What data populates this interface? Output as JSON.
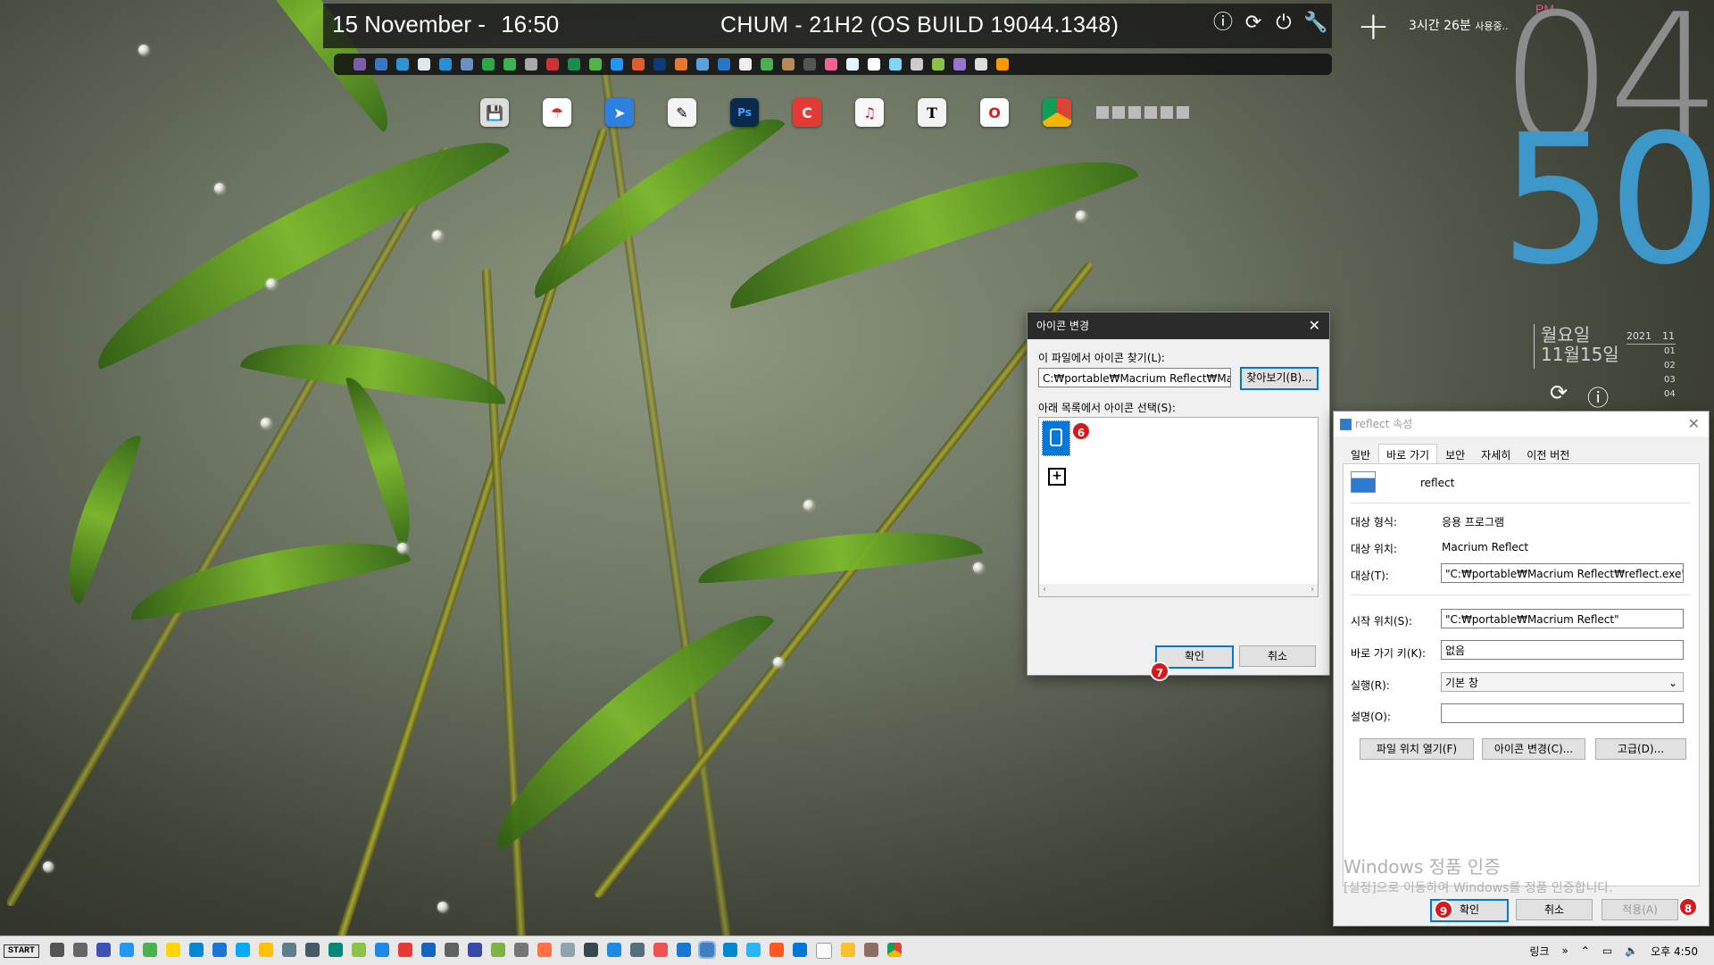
{
  "topbar": {
    "date": "15 November -",
    "time": "16:50",
    "title": "CHUM - 21H2 (OS BUILD 19044.1348)"
  },
  "usage": {
    "text": "3시간 26분",
    "suffix": "사용중.."
  },
  "clock": {
    "ampm": "PM",
    "hour": "04",
    "minute": "50",
    "dayname": "월요일",
    "date": "11월15일",
    "year": "2021",
    "month": "11",
    "days": [
      "01",
      "02",
      "03",
      "04"
    ]
  },
  "icon_dialog": {
    "title": "아이콘 변경",
    "find_label": "이 파일에서 아이콘 찾기(L):",
    "path_value": "C:₩portable₩Macrium Reflect₩Macriu",
    "browse_label": "찾아보기(B)...",
    "list_label": "아래 목록에서 아이콘 선택(S):",
    "ok_label": "확인",
    "cancel_label": "취소",
    "badge_a": "6",
    "badge_b": "7"
  },
  "props": {
    "title": "reflect 속성",
    "tabs": [
      "일반",
      "바로 가기",
      "보안",
      "자세히",
      "이전 버전"
    ],
    "app_name": "reflect",
    "target_type_label": "대상 형식:",
    "target_type_value": "응용 프로그램",
    "target_loc_label": "대상 위치:",
    "target_loc_value": "Macrium Reflect",
    "target_label": "대상(T):",
    "target_value": "\"C:₩portable₩Macrium Reflect₩reflect.exe\"",
    "start_label": "시작 위치(S):",
    "start_value": "\"C:₩portable₩Macrium Reflect\"",
    "hotkey_label": "바로 가기 키(K):",
    "hotkey_value": "없음",
    "run_label": "실행(R):",
    "run_value": "기본 창",
    "comment_label": "설명(O):",
    "comment_value": "",
    "btn_open_loc": "파일 위치 열기(F)",
    "btn_change_icon": "아이콘 변경(C)...",
    "btn_advanced": "고급(D)...",
    "ok_label": "확인",
    "cancel_label": "취소",
    "apply_label": "적용(A)",
    "badge_ok": "9",
    "badge_apply": "8"
  },
  "watermark": {
    "line1": "Windows 정품 인증",
    "line2": "[설정]으로 이동하여 Windows를 정품 인증합니다."
  },
  "taskbar": {
    "start": "START",
    "links": "링크",
    "time": "오후 4:50"
  }
}
